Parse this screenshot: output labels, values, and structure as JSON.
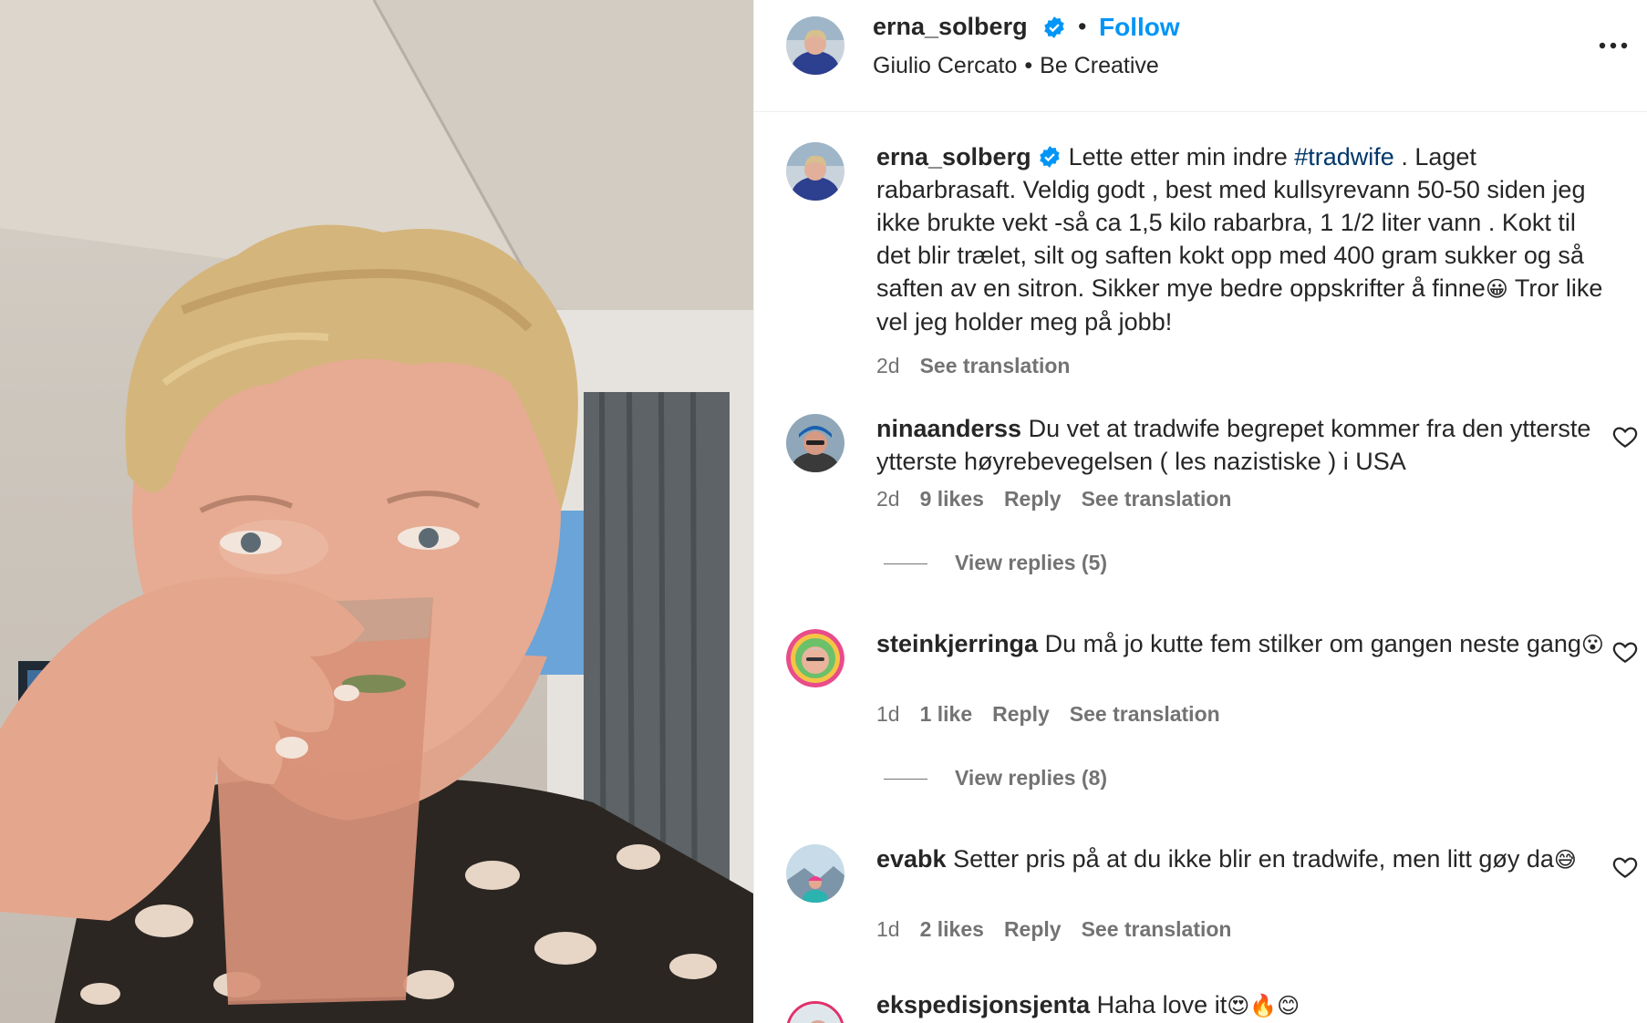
{
  "header": {
    "username": "erna_solberg",
    "follow_label": "Follow",
    "audio_artist": "Giulio Cercato",
    "audio_title": "Be Creative",
    "separator": "•"
  },
  "caption": {
    "username": "erna_solberg",
    "text_before": "Lette etter min indre ",
    "hashtag": "#tradwife",
    "text_after": " . Laget rabarbrasaft. Veldig godt , best med kullsyrevann 50-50 siden jeg ikke brukte vekt -så ca 1,5 kilo rabarbra, 1 1/2 liter vann . Kokt til det blir trælet, silt og saften kokt opp med 400 gram sukker og så saften av en sitron. Sikker mye bedre oppskrifter å finne",
    "emoji": "😀",
    "text_end": " Tror like vel jeg holder meg på jobb!",
    "time": "2d",
    "see_translation": "See translation"
  },
  "comments": [
    {
      "username": "ninaanderss",
      "text": "Du vet at tradwife begrepet kommer fra den ytterste ytterste høyrebevegelsen ( les nazistiske ) i USA",
      "emoji": "",
      "time": "2d",
      "likes": "9 likes",
      "reply": "Reply",
      "see_translation": "See translation",
      "view_replies": "View replies (5)"
    },
    {
      "username": "steinkjerringa",
      "text": "Du må jo kutte fem stilker om gangen neste gang",
      "emoji": "😮",
      "time": "1d",
      "likes": "1 like",
      "reply": "Reply",
      "see_translation": "See translation",
      "view_replies": "View replies (8)"
    },
    {
      "username": "evabk",
      "text": "Setter pris på at du ikke blir en tradwife, men litt gøy da",
      "emoji": "😅",
      "time": "1d",
      "likes": "2 likes",
      "reply": "Reply",
      "see_translation": "See translation"
    },
    {
      "username": "ekspedisjonsjenta",
      "text": "Haha love it",
      "emoji": "😍🔥😊"
    }
  ],
  "colors": {
    "accent": "#0095f6",
    "hashtag": "#00376b",
    "muted": "#737373",
    "text": "#262626",
    "verified": "#0095f6"
  },
  "icons": {
    "verified": "verified-badge-icon",
    "more": "more-options-icon",
    "like": "heart-icon"
  }
}
